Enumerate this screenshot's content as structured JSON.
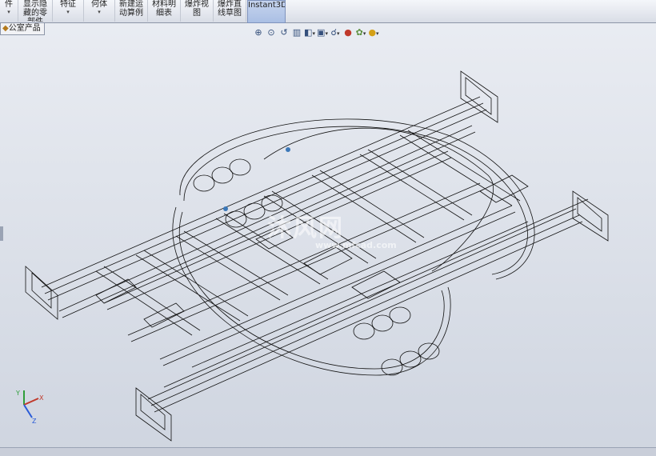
{
  "ribbon": {
    "buttons": [
      {
        "label": "件",
        "has_arrow": true
      },
      {
        "label": "显示隐\n藏的零\n部件",
        "has_arrow": false
      },
      {
        "label": "特征",
        "has_arrow": true
      },
      {
        "label": "何体",
        "has_arrow": true
      },
      {
        "label": "新建运\n动算例",
        "has_arrow": false
      },
      {
        "label": "材料明\n细表",
        "has_arrow": false
      },
      {
        "label": "爆炸视\n图",
        "has_arrow": false
      },
      {
        "label": "爆炸直\n线草图",
        "has_arrow": false
      },
      {
        "label": "Instant3D",
        "has_arrow": false,
        "active": true
      }
    ]
  },
  "tab": {
    "label": "公室产品"
  },
  "view_toolbar": {
    "icons": [
      "zoom-to-fit-icon",
      "zoom-area-icon",
      "previous-view-icon",
      "section-view-icon",
      "view-orientation-icon",
      "display-style-icon",
      "hide-show-icon",
      "edit-appearance-icon",
      "apply-scene-icon",
      "view-settings-icon"
    ]
  },
  "watermark": {
    "main": "沐风网",
    "sub": "www.mfcad.com"
  },
  "triad": {
    "x": "X",
    "y": "Y",
    "z": "Z"
  },
  "colors": {
    "accent": "#7f93bd",
    "model_line": "#111111"
  }
}
